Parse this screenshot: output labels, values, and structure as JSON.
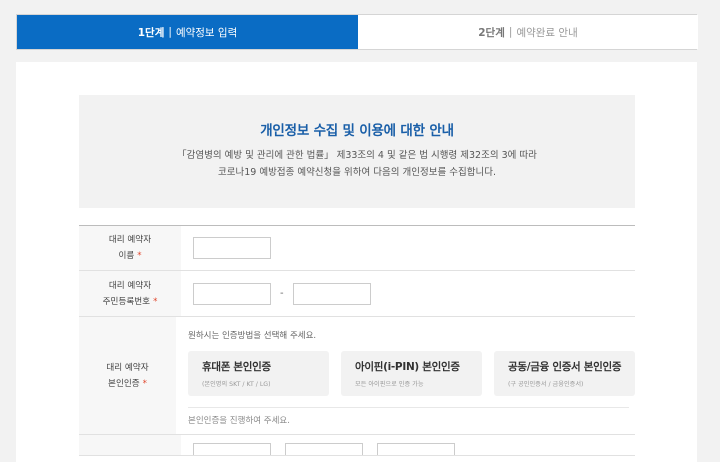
{
  "steps": [
    {
      "num": "1단계",
      "sep": "|",
      "label": "예약정보 입력"
    },
    {
      "num": "2단계",
      "sep": "|",
      "label": "예약완료 안내"
    }
  ],
  "notice": {
    "title": "개인정보 수집 및 이용에 대한 안내",
    "line1": "「감염병의 예방 및 관리에 관한 법률」 제33조의 4 및 같은 법 시행령 제32조의 3에 따라",
    "line2": "코로나19 예방접종 예약신청을 위하여 다음의 개인정보를 수집합니다."
  },
  "form": {
    "name": {
      "label1": "대리 예약자",
      "label2": "이름",
      "req": "*"
    },
    "rrn": {
      "label1": "대리 예약자",
      "label2": "주민등록번호",
      "req": "*",
      "dash": "-"
    },
    "auth": {
      "label1": "대리 예약자",
      "label2": "본인인증",
      "req": "*",
      "hint": "원하시는 인증방법을 선택해 주세요.",
      "options": [
        {
          "title": "휴대폰 본인인증",
          "sub": "(본인명의 SKT / KT / LG)"
        },
        {
          "title": "아이핀(i-PIN) 본인인증",
          "sub": "모든 아이핀으로 인증 가능"
        },
        {
          "title": "공동/금융 인증서 본인인증",
          "sub": "(구 공인인증서 / 금융인증서)"
        }
      ],
      "status": "본인인증을 진행하여 주세요."
    }
  }
}
